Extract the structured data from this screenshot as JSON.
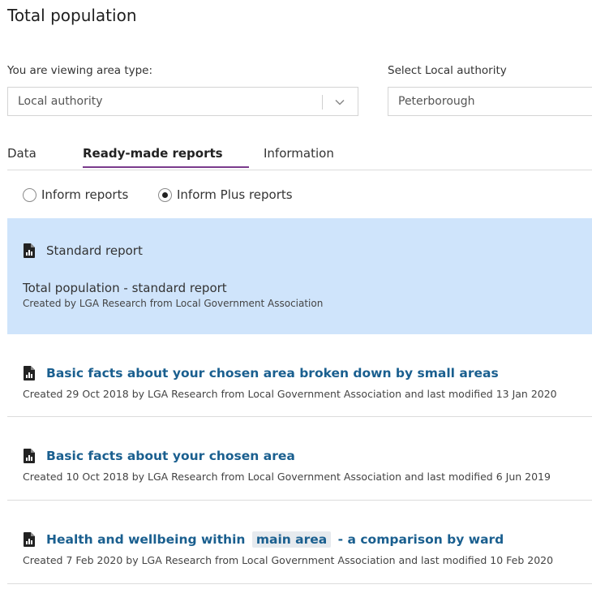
{
  "page": {
    "title": "Total population"
  },
  "filters": {
    "area_type_label": "You are viewing area type:",
    "area_type_value": "Local authority",
    "local_authority_label": "Select Local authority",
    "local_authority_value": "Peterborough"
  },
  "tabs": [
    {
      "label": "Data",
      "active": false
    },
    {
      "label": "Ready-made reports",
      "active": true
    },
    {
      "label": "Information",
      "active": false
    }
  ],
  "report_types": [
    {
      "label": "Inform reports",
      "selected": false
    },
    {
      "label": "Inform Plus reports",
      "selected": true
    }
  ],
  "standard_report": {
    "heading": "Standard report",
    "title": "Total population - standard report",
    "subtitle": "Created by LGA Research from Local Government Association"
  },
  "reports": [
    {
      "title": "Basic facts about your chosen area broken down by small areas",
      "meta": "Created 29 Oct 2018 by LGA Research from Local Government Association and last modified 13 Jan 2020"
    },
    {
      "title": "Basic facts about your chosen area",
      "meta": "Created 10 Oct 2018 by LGA Research from Local Government Association and last modified 6 Jun 2019"
    },
    {
      "title_prefix": "Health and wellbeing within",
      "title_highlight": "main area",
      "title_suffix": "- a comparison by ward",
      "meta": "Created 7 Feb 2020 by LGA Research from Local Government Association and last modified 10 Feb 2020"
    }
  ],
  "icons": {
    "report": "report-document-icon",
    "dropdown": "chevron-down-icon"
  },
  "colors": {
    "accent_tab": "#7a3b8c",
    "link": "#1a5f8f",
    "card_bg": "#cfe4fb"
  }
}
